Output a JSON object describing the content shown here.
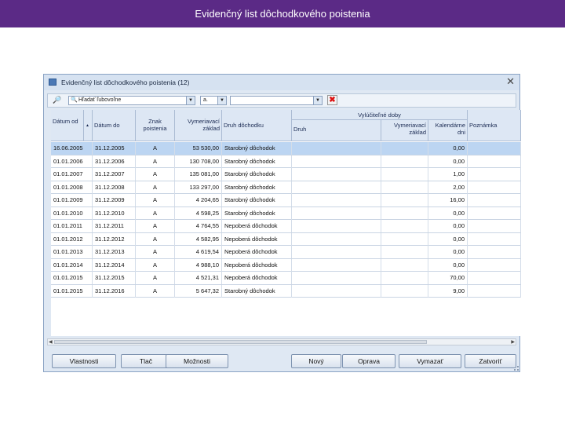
{
  "slide": {
    "title": "Evidenčný list dôchodkového poistenia"
  },
  "window": {
    "title": "Evidenčný list dôchodkového poistenia (12)",
    "close_glyph": "✕"
  },
  "toolbar": {
    "search_text": "Hľadať ľubovoľne",
    "filter_value": "a.",
    "search_field_value": "",
    "clear_glyph": "✖"
  },
  "grid": {
    "headers": {
      "datum_od": "Dátum od",
      "sort_mark": "▲",
      "datum_do": "Dátum do",
      "znak": "Znak poistenia",
      "vymeriavaci": "Vymeriavací základ",
      "druh_dochodku": "Druh dôchodku",
      "vylucitelne": "Vylúčiteľné doby",
      "druh": "Druh",
      "vym_zaklad": "Vymeriavací základ",
      "kalendarne": "Kalendárne dni",
      "poznamka": "Poznámka"
    },
    "rows": [
      {
        "od": "16.06.2005",
        "do": "31.12.2005",
        "znak": "A",
        "zaklad": "53 530,00",
        "druh": "Starobný dôchodok",
        "dni": "0,00",
        "selected": true
      },
      {
        "od": "01.01.2006",
        "do": "31.12.2006",
        "znak": "A",
        "zaklad": "130 708,00",
        "druh": "Starobný dôchodok",
        "dni": "0,00",
        "selected": false
      },
      {
        "od": "01.01.2007",
        "do": "31.12.2007",
        "znak": "A",
        "zaklad": "135 081,00",
        "druh": "Starobný dôchodok",
        "dni": "1,00",
        "selected": false
      },
      {
        "od": "01.01.2008",
        "do": "31.12.2008",
        "znak": "A",
        "zaklad": "133 297,00",
        "druh": "Starobný dôchodok",
        "dni": "2,00",
        "selected": false
      },
      {
        "od": "01.01.2009",
        "do": "31.12.2009",
        "znak": "A",
        "zaklad": "4 204,65",
        "druh": "Starobný dôchodok",
        "dni": "16,00",
        "selected": false
      },
      {
        "od": "01.01.2010",
        "do": "31.12.2010",
        "znak": "A",
        "zaklad": "4 598,25",
        "druh": "Starobný dôchodok",
        "dni": "0,00",
        "selected": false
      },
      {
        "od": "01.01.2011",
        "do": "31.12.2011",
        "znak": "A",
        "zaklad": "4 764,55",
        "druh": "Nepoberá dôchodok",
        "dni": "0,00",
        "selected": false
      },
      {
        "od": "01.01.2012",
        "do": "31.12.2012",
        "znak": "A",
        "zaklad": "4 582,95",
        "druh": "Nepoberá dôchodok",
        "dni": "0,00",
        "selected": false
      },
      {
        "od": "01.01.2013",
        "do": "31.12.2013",
        "znak": "A",
        "zaklad": "4 619,54",
        "druh": "Nepoberá dôchodok",
        "dni": "0,00",
        "selected": false
      },
      {
        "od": "01.01.2014",
        "do": "31.12.2014",
        "znak": "A",
        "zaklad": "4 988,10",
        "druh": "Nepoberá dôchodok",
        "dni": "0,00",
        "selected": false
      },
      {
        "od": "01.01.2015",
        "do": "31.12.2015",
        "znak": "A",
        "zaklad": "4 521,31",
        "druh": "Nepoberá dôchodok",
        "dni": "70,00",
        "selected": false
      },
      {
        "od": "01.01.2015",
        "do": "31.12.2016",
        "znak": "A",
        "zaklad": "5 647,32",
        "druh": "Starobný dôchodok",
        "dni": "9,00",
        "selected": false
      }
    ]
  },
  "buttons": {
    "vlastnosti": "Vlastnosti",
    "tlac": "Tlač",
    "moznosti": "Možnosti",
    "novy": "Nový",
    "oprava": "Oprava",
    "vymazat": "Vymazať",
    "zatvorit": "Zatvoriť"
  },
  "colors": {
    "slide_title_bg": "#5b2a86",
    "selected_row": "#bcd5f2",
    "header_bg": "#dde7f4"
  }
}
